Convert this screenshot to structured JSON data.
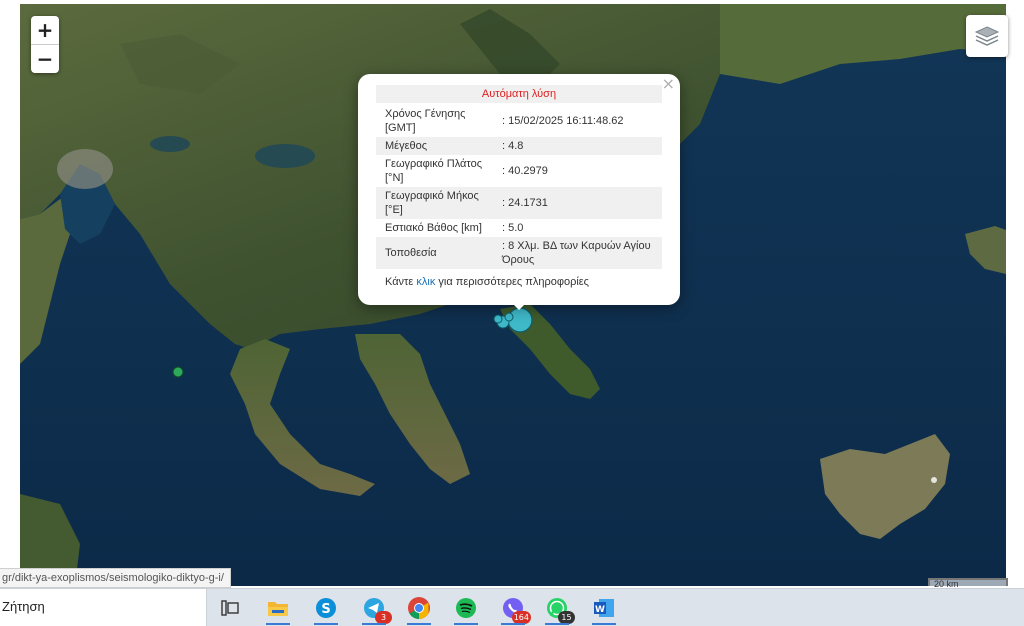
{
  "map": {
    "zoom_in": "+",
    "zoom_out": "−",
    "layers_icon": "layers-icon",
    "scale_label": "20 km"
  },
  "popup": {
    "close": "×",
    "title": "Αυτόματη λύση",
    "rows": [
      {
        "label": "Χρόνος Γένησης [GMT]",
        "value": ": 15/02/2025 16:11:48.62"
      },
      {
        "label": "Μέγεθος",
        "value": ": 4.8"
      },
      {
        "label": "Γεωγραφικό Πλάτος [°N]",
        "value": ": 40.2979"
      },
      {
        "label": "Γεωγραφικό Μήκος [°E]",
        "value": ": 24.1731"
      },
      {
        "label": "Εστιακό Βάθος [km]",
        "value": ": 5.0"
      },
      {
        "label": "Τοποθεσία",
        "value": ": 8 Χλμ. ΒΔ των Καρυών Αγίου Όρους"
      }
    ],
    "footer_before": "Κάντε ",
    "footer_link": "κλικ",
    "footer_after": " για περισσότερες πληροφορίες"
  },
  "status_url": "gr/dikt-ya-exoplismos/seismologiko-diktyo-g-i/",
  "taskbar": {
    "search_text": "Ζήτηση",
    "apps": [
      {
        "name": "task-view-icon",
        "badge": ""
      },
      {
        "name": "file-explorer-icon",
        "badge": ""
      },
      {
        "name": "skype-icon",
        "badge": ""
      },
      {
        "name": "telegram-icon",
        "badge": "3"
      },
      {
        "name": "chrome-icon",
        "badge": ""
      },
      {
        "name": "spotify-icon",
        "badge": ""
      },
      {
        "name": "viber-icon",
        "badge": "164"
      },
      {
        "name": "whatsapp-icon",
        "badge": "15"
      },
      {
        "name": "word-icon",
        "badge": ""
      }
    ]
  },
  "colors": {
    "sea": "#0f2f4f",
    "land": "#4a5a34",
    "marker_teal": "#3fb8c8",
    "marker_green": "#2ea85a",
    "popup_title": "#e02020",
    "link": "#1a6fb8"
  }
}
